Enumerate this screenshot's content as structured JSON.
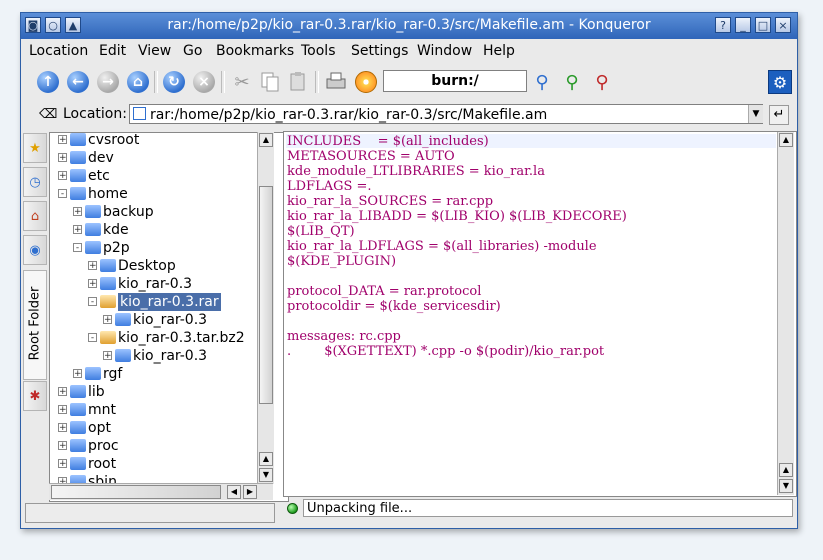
{
  "window": {
    "title": "rar:/home/p2p/kio_rar-0.3.rar/kio_rar-0.3/src/Makefile.am - Konqueror",
    "controls": [
      "?",
      "_",
      "□",
      "×"
    ]
  },
  "menubar": [
    "Location",
    "Edit",
    "View",
    "Go",
    "Bookmarks",
    "Tools",
    "Settings",
    "Window",
    "Help"
  ],
  "toolbar": {
    "icons": [
      "up-icon",
      "back-icon",
      "forward-icon",
      "home-icon",
      "reload-icon",
      "stop-icon",
      "cut-icon",
      "copy-icon",
      "paste-icon",
      "print-icon",
      "burn-icon",
      "zoom-icon",
      "zoom-in-icon",
      "zoom-out-icon",
      "konqueror-gear-icon"
    ],
    "burn_field": "burn:/"
  },
  "location": {
    "label": "Location:",
    "value": "rar:/home/p2p/kio_rar-0.3.rar/kio_rar-0.3/src/Makefile.am"
  },
  "sidebar": {
    "root_folder_label": "Root Folder"
  },
  "tree": [
    {
      "label": "cvsroot",
      "depth": 0,
      "expander": "+"
    },
    {
      "label": "dev",
      "depth": 0,
      "expander": "+"
    },
    {
      "label": "etc",
      "depth": 0,
      "expander": "+"
    },
    {
      "label": "home",
      "depth": 0,
      "expander": "-"
    },
    {
      "label": "backup",
      "depth": 1,
      "expander": "+"
    },
    {
      "label": "kde",
      "depth": 1,
      "expander": "+"
    },
    {
      "label": "p2p",
      "depth": 1,
      "expander": "-"
    },
    {
      "label": "Desktop",
      "depth": 2,
      "expander": "+"
    },
    {
      "label": "kio_rar-0.3",
      "depth": 2,
      "expander": "+"
    },
    {
      "label": "kio_rar-0.3.rar",
      "depth": 2,
      "expander": "-",
      "selected": true,
      "archive": true
    },
    {
      "label": "kio_rar-0.3",
      "depth": 3,
      "expander": "+"
    },
    {
      "label": "kio_rar-0.3.tar.bz2",
      "depth": 2,
      "expander": "-",
      "archive": true
    },
    {
      "label": "kio_rar-0.3",
      "depth": 3,
      "expander": "+"
    },
    {
      "label": "rgf",
      "depth": 1,
      "expander": "+"
    },
    {
      "label": "lib",
      "depth": 0,
      "expander": "+"
    },
    {
      "label": "mnt",
      "depth": 0,
      "expander": "+"
    },
    {
      "label": "opt",
      "depth": 0,
      "expander": "+"
    },
    {
      "label": "proc",
      "depth": 0,
      "expander": "+"
    },
    {
      "label": "root",
      "depth": 0,
      "expander": "+"
    },
    {
      "label": "sbin",
      "depth": 0,
      "expander": "+"
    }
  ],
  "editor_lines": [
    "INCLUDES    = $(all_includes)",
    "METASOURCES = AUTO",
    "kde_module_LTLIBRARIES = kio_rar.la",
    "LDFLAGS =.",
    "kio_rar_la_SOURCES = rar.cpp",
    "kio_rar_la_LIBADD = $(LIB_KIO) $(LIB_KDECORE)",
    "$(LIB_QT)",
    "kio_rar_la_LDFLAGS = $(all_libraries) -module",
    "$(KDE_PLUGIN)",
    "",
    "protocol_DATA = rar.protocol",
    "protocoldir = $(kde_servicesdir)",
    "",
    "messages: rc.cpp",
    ".        $(XGETTEXT) *.cpp -o $(podir)/kio_rar.pot"
  ],
  "status": {
    "text": "Unpacking file..."
  }
}
